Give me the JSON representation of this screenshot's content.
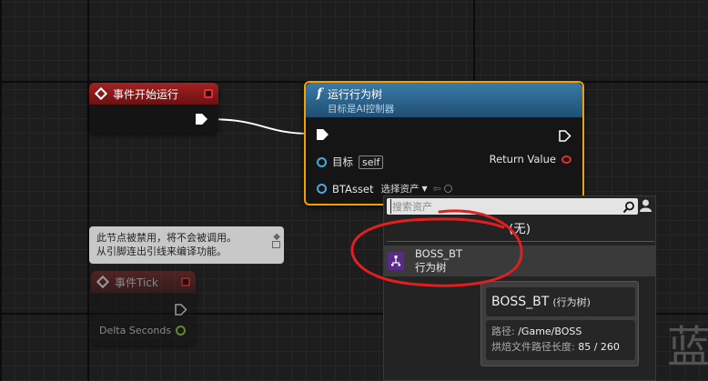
{
  "begin_node": {
    "title": "事件开始运行"
  },
  "bt_node": {
    "title": "运行行为树",
    "subtitle": "目标是AI控制器",
    "target_label": "目标",
    "target_value": "self",
    "return_label": "Return Value",
    "asset_label": "BTAsset",
    "asset_select": "选择资产"
  },
  "disabled_tooltip": {
    "line1": "此节点被禁用，将不会被调用。",
    "line2": "从引脚连出引线来编译功能。"
  },
  "tick_node": {
    "title": "事件Tick",
    "delta_label": "Delta Seconds"
  },
  "asset_picker": {
    "search_placeholder": "搜索资产",
    "none_option": "(无)",
    "item_name": "BOSS_BT",
    "item_type": "行为树"
  },
  "asset_tooltip": {
    "title": "BOSS_BT",
    "title_type": "(行为树)",
    "path_label": "路径:",
    "path_value": "/Game/BOSS",
    "bake_label": "烘焙文件路径长度:",
    "bake_value": "85 / 260"
  },
  "watermark": "蓝",
  "colors": {
    "event_header": "#8b1a1a",
    "function_header": "#2a5f86",
    "selection_outline": "#f0a000",
    "annotation_circle": "#e02020",
    "object_pin": "#4aa8e0"
  }
}
